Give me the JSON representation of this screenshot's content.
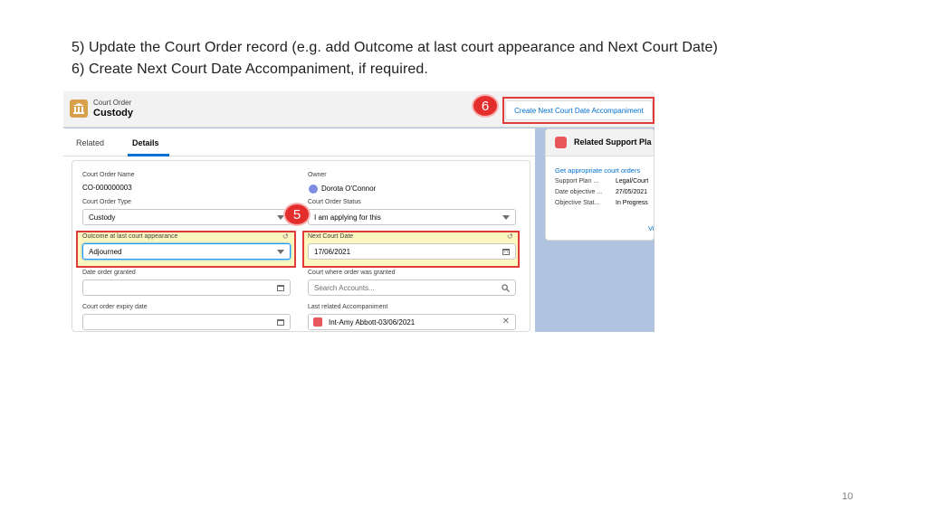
{
  "slide": {
    "line1": "5) Update the Court Order record (e.g. add Outcome at last court appearance and Next Court Date)",
    "line2": "6) Create Next Court Date Accompaniment, if required.",
    "page_number": "10"
  },
  "header": {
    "record_type": "Court Order",
    "record_name": "Custody",
    "create_button": "Create Next Court Date Accompaniment",
    "step6": "6"
  },
  "tabs": {
    "related": "Related",
    "details": "Details"
  },
  "step5": "5",
  "fields": {
    "court_order_name_label": "Court Order Name",
    "court_order_name_value": "CO-000000003",
    "owner_label": "Owner",
    "owner_value": "Dorota O'Connor",
    "court_order_type_label": "Court Order Type",
    "court_order_type_value": "Custody",
    "court_order_status_label": "Court Order Status",
    "court_order_status_value": "I am applying for this",
    "outcome_label": "Outcome at last court appearance",
    "outcome_value": "Adjourned",
    "next_court_date_label": "Next Court Date",
    "next_court_date_value": "17/06/2021",
    "date_granted_label": "Date order granted",
    "court_granted_label": "Court where order was granted",
    "court_granted_placeholder": "Search Accounts...",
    "expiry_label": "Court order expiry date",
    "last_accompaniment_label": "Last related Accompaniment",
    "last_accompaniment_value": "Int-Amy Abbott-03/06/2021"
  },
  "side": {
    "title": "Related Support Pla",
    "link": "Get appropriate court orders",
    "rows": [
      {
        "label": "Support Plan ...",
        "value": "Legal/Court"
      },
      {
        "label": "Date objective ...",
        "value": "27/05/2021"
      },
      {
        "label": "Objective Stat...",
        "value": "In Progress"
      }
    ],
    "view": "Vi"
  },
  "colors": {
    "accent": "#0070d2",
    "highlight_red": "#e03a3a",
    "highlight_yellow": "#fbf7bf",
    "backdrop": "#b0c4df"
  }
}
